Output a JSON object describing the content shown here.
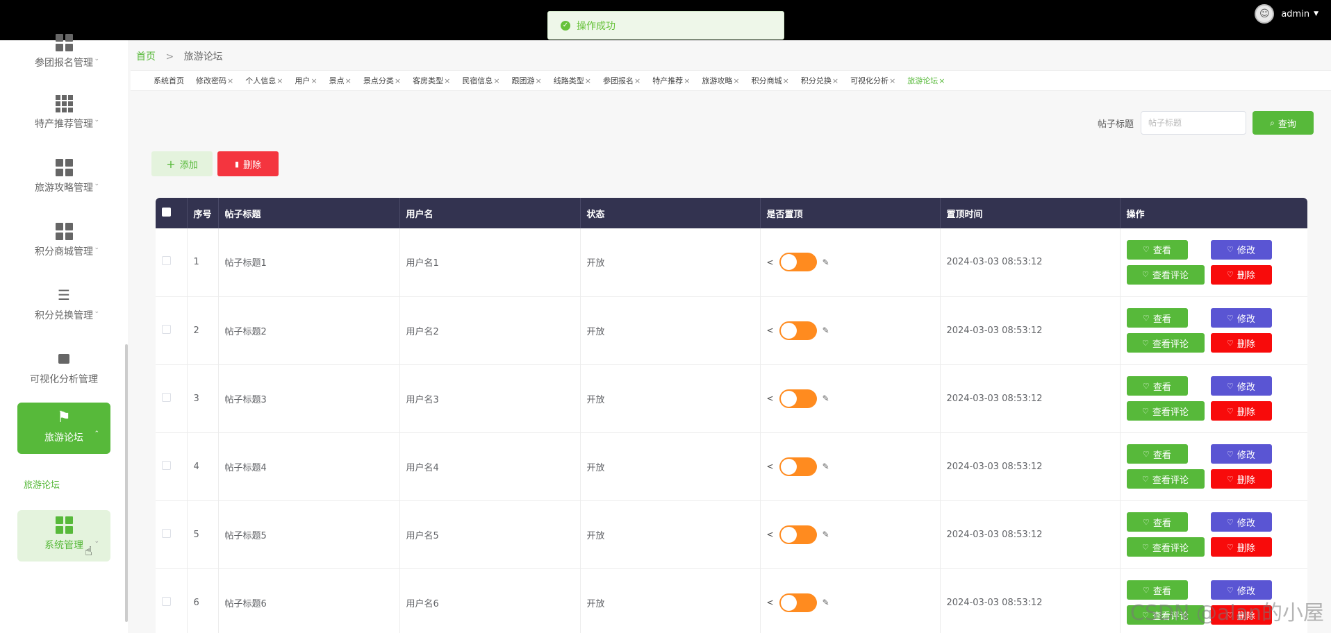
{
  "toast": {
    "text": "操作成功"
  },
  "user": {
    "name": "admin"
  },
  "sidebar": {
    "items": [
      {
        "label": "参团报名管理",
        "icon": "grid-icon"
      },
      {
        "label": "特产推荐管理",
        "icon": "grid9-icon"
      },
      {
        "label": "旅游攻略管理",
        "icon": "grid-icon"
      },
      {
        "label": "积分商城管理",
        "icon": "grid-icon"
      },
      {
        "label": "积分兑换管理",
        "icon": "list-indent-icon"
      },
      {
        "label": "可视化分析管理",
        "icon": "brush-icon"
      },
      {
        "label": "旅游论坛",
        "icon": "flag-icon"
      },
      {
        "label": "系统管理",
        "icon": "grid-icon"
      }
    ],
    "submenu": "旅游论坛"
  },
  "breadcrumb": {
    "home": "首页",
    "sep": ">",
    "current": "旅游论坛"
  },
  "tags": [
    "系统首页",
    "修改密码",
    "个人信息",
    "用户",
    "景点",
    "景点分类",
    "客房类型",
    "民宿信息",
    "跟团游",
    "线路类型",
    "参团报名",
    "特产推荐",
    "旅游攻略",
    "积分商城",
    "积分兑换",
    "可视化分析",
    "旅游论坛"
  ],
  "search": {
    "label": "帖子标题",
    "placeholder": "帖子标题",
    "button": "查询"
  },
  "actions": {
    "add": "添加",
    "delete": "删除"
  },
  "table": {
    "headers": [
      "",
      "序号",
      "帖子标题",
      "用户名",
      "状态",
      "是否置顶",
      "置顶时间",
      "操作"
    ],
    "rows": [
      {
        "id": "1",
        "title": "帖子标题1",
        "user": "用户名1",
        "status": "开放",
        "time": "2024-03-03 08:53:12"
      },
      {
        "id": "2",
        "title": "帖子标题2",
        "user": "用户名2",
        "status": "开放",
        "time": "2024-03-03 08:53:12"
      },
      {
        "id": "3",
        "title": "帖子标题3",
        "user": "用户名3",
        "status": "开放",
        "time": "2024-03-03 08:53:12"
      },
      {
        "id": "4",
        "title": "帖子标题4",
        "user": "用户名4",
        "status": "开放",
        "time": "2024-03-03 08:53:12"
      },
      {
        "id": "5",
        "title": "帖子标题5",
        "user": "用户名5",
        "status": "开放",
        "time": "2024-03-03 08:53:12"
      },
      {
        "id": "6",
        "title": "帖子标题6",
        "user": "用户名6",
        "status": "开放",
        "time": "2024-03-03 08:53:12"
      }
    ],
    "ops": {
      "view": "查看",
      "edit": "修改",
      "comment": "查看评论",
      "delete": "删除"
    }
  },
  "watermark": "CSDN @alan的小屋",
  "colors": {
    "primary": "#57b93a",
    "header": "#333350",
    "danger": "#f80b0b",
    "edit": "#5a55d3",
    "toggle": "#ff8b1f"
  }
}
